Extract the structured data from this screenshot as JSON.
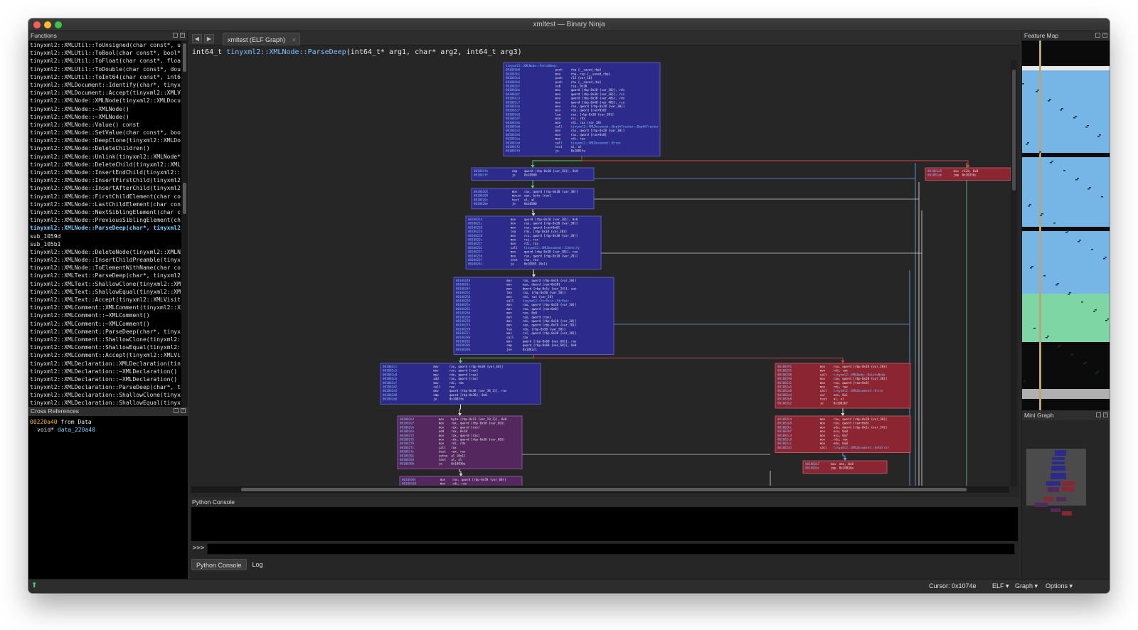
{
  "window": {
    "title": "xmltest — Binary Ninja"
  },
  "colors": {
    "block_blue": "#2c2a8a",
    "block_purple": "#54285e",
    "block_red": "#8b2532",
    "edge_white": "#d8d8d8",
    "edge_green": "#64c864",
    "edge_blue": "#6ea0d8",
    "edge_red": "#d24646",
    "selected_fn": "#7ad0ff",
    "xref_addr": "#f3b53c"
  },
  "functions_panel": {
    "title": "Functions",
    "items": [
      "tinyxml2::XMLUtil::ToUnsigned(char const*, unsigned int*)",
      "tinyxml2::XMLUtil::ToBool(char const*, bool*)",
      "tinyxml2::XMLUtil::ToFloat(char const*, float*)",
      "tinyxml2::XMLUtil::ToDouble(char const*, double*)",
      "tinyxml2::XMLUtil::ToInt64(char const*, int64_t*)",
      "tinyxml2::XMLDocument::Identify(char*, tinyxml2::XMLNode**)",
      "tinyxml2::XMLDocument::Accept(tinyxml2::XMLVisitor*) const",
      "tinyxml2::XMLNode::XMLNode(tinyxml2::XMLDocument*)",
      "tinyxml2::XMLNode::~XMLNode()",
      "tinyxml2::XMLNode::~XMLNode()",
      "tinyxml2::XMLNode::Value() const",
      "tinyxml2::XMLNode::SetValue(char const*, bool)",
      "tinyxml2::XMLNode::DeepClone(tinyxml2::XMLDocument*) const",
      "tinyxml2::XMLNode::DeleteChildren()",
      "tinyxml2::XMLNode::Unlink(tinyxml2::XMLNode*)",
      "tinyxml2::XMLNode::DeleteChild(tinyxml2::XMLNode*)",
      "tinyxml2::XMLNode::InsertEndChild(tinyxml2::XMLNode*)",
      "tinyxml2::XMLNode::InsertFirstChild(tinyxml2::XMLNode*)",
      "tinyxml2::XMLNode::InsertAfterChild(tinyxml2::XMLNode*)",
      "tinyxml2::XMLNode::FirstChildElement(char const*) const",
      "tinyxml2::XMLNode::LastChildElement(char const*) const",
      "tinyxml2::XMLNode::NextSiblingElement(char const*) const",
      "tinyxml2::XMLNode::PreviousSiblingElement(char const*) const",
      "tinyxml2::XMLNode::ParseDeep(char*, tinyxml2::StrPair*)",
      "sub_1059d",
      "sub_105b1",
      "tinyxml2::XMLNode::DeleteNode(tinyxml2::XMLNode*)",
      "tinyxml2::XMLNode::InsertChildPreamble(tinyxml2::XMLNode*) const",
      "tinyxml2::XMLNode::ToElementWithName(char const*) const",
      "tinyxml2::XMLText::ParseDeep(char*, tinyxml2::StrPair*)",
      "tinyxml2::XMLText::ShallowClone(tinyxml2::XMLDocument*) const",
      "tinyxml2::XMLText::ShallowEqual(tinyxml2::XMLNode const*) const",
      "tinyxml2::XMLText::Accept(tinyxml2::XMLVisitor*) const",
      "tinyxml2::XMLComment::XMLComment(tinyxml2::XMLDocument*)",
      "tinyxml2::XMLComment::~XMLComment()",
      "tinyxml2::XMLComment::~XMLComment()",
      "tinyxml2::XMLComment::ParseDeep(char*, tinyxml2::StrPair*)",
      "tinyxml2::XMLComment::ShallowClone(tinyxml2::XMLDocument*) const",
      "tinyxml2::XMLComment::ShallowEqual(tinyxml2::XMLNode const*) const",
      "tinyxml2::XMLComment::Accept(tinyxml2::XMLVisitor*) const",
      "tinyxml2::XMLDeclaration::XMLDeclaration(tinyxml2::XMLDocument*)",
      "tinyxml2::XMLDeclaration::~XMLDeclaration()",
      "tinyxml2::XMLDeclaration::~XMLDeclaration()",
      "tinyxml2::XMLDeclaration::ParseDeep(char*, tinyxml2::StrPair*)",
      "tinyxml2::XMLDeclaration::ShallowClone(tinyxml2::XMLDocument*) const",
      "tinyxml2::XMLDeclaration::ShallowEqual(tinyxml2::XMLNode const*) const"
    ],
    "selected_index": 23
  },
  "xrefs_panel": {
    "title": "Cross References",
    "entry_addr": "00220a40",
    "entry_from": "from Data",
    "entry_type": "void*",
    "entry_data": "data_220a40"
  },
  "tab": {
    "label": "xmltest (ELF Graph)",
    "close": "×"
  },
  "nav": {
    "back": "◀",
    "forward": "▶"
  },
  "signature": {
    "ret_type": "int64_t",
    "func_name": "tinyxml2::XMLNode::ParseDeep",
    "params": "(int64_t* arg1, char* arg2, int64_t arg3)"
  },
  "graph": {
    "blocks": [
      {
        "id": "entry",
        "color": "blue",
        "lines": [
          [
            "",
            "",
            "tinyxml2::XMLNode::ParseDeep:"
          ],
          [
            "001081b0",
            "push",
            "rbp {__saved_rbp}"
          ],
          [
            "001081b1",
            "mov",
            "rbp, rsp {__saved_rbp}"
          ],
          [
            "001081b4",
            "push",
            "r12 {var_10}"
          ],
          [
            "001081b6",
            "push",
            "rbx {__saved_rbx}"
          ],
          [
            "001081b7",
            "sub",
            "rsp, 0x30"
          ],
          [
            "001081bb",
            "mov",
            "qword [rbp-0x28 {var_30}], rdi"
          ],
          [
            "001081bf",
            "mov",
            "qword [rbp-0x30 {var_38}], rsi"
          ],
          [
            "001081c3",
            "mov",
            "qword [rbp-0x38 {var_40}], rdx"
          ],
          [
            "001081c7",
            "mov",
            "qword [rbp-0x40 {var_48}], rcx"
          ],
          [
            "001081cb",
            "mov",
            "rax, qword [rbp-0x28 {var_30}]"
          ],
          [
            "001081cf",
            "mov",
            "rdx, qword [rax+0x8]"
          ],
          [
            "001081d3",
            "lea",
            "rax, [rbp-0x30 {var_38}]"
          ],
          [
            "001081d7",
            "mov",
            "rsi, rdx"
          ],
          [
            "001081da",
            "mov",
            "rdi, rax {var_38}"
          ],
          [
            "001081dd",
            "call",
            "tinyxml2::XMLDocument::DepthTracker::DepthTracker"
          ],
          [
            "001081e2",
            "mov",
            "rax, qword [rbp-0x28 {var_30}]"
          ],
          [
            "001081e6",
            "mov",
            "rax, qword [rax+0x8]"
          ],
          [
            "001081ea",
            "mov",
            "rdi, rax"
          ],
          [
            "001081ed",
            "call",
            "tinyxml2::XMLDocument::Error"
          ],
          [
            "001081f2",
            "test",
            "al, al"
          ],
          [
            "001081f4",
            "je",
            "0x1081fa"
          ]
        ]
      },
      {
        "id": "b2",
        "color": "blue",
        "lines": [
          [
            "001081fa",
            "cmp",
            "qword [rbp-0x30 {var_38}], 0x0"
          ],
          [
            "001081ff",
            "je",
            "0x10580"
          ]
        ]
      },
      {
        "id": "b3",
        "color": "blue",
        "lines": [
          [
            "00108205",
            "mov",
            "rax, qword [rbp-0x30 {var_38}]"
          ],
          [
            "00108209",
            "movzx",
            "eax, byte [rax]"
          ],
          [
            "0010820c",
            "test",
            "al, al"
          ],
          [
            "0010820e",
            "je",
            "0x10580"
          ]
        ]
      },
      {
        "id": "b4",
        "color": "blue",
        "lines": [
          [
            "00108214",
            "mov",
            "qword [rbp-0x18 {var_20}], 0x0"
          ],
          [
            "0010821c",
            "mov",
            "rax, qword [rbp-0x28 {var_30}]"
          ],
          [
            "00108220",
            "mov",
            "rax, qword [rax+0x8]"
          ],
          [
            "00108224",
            "lea",
            "rdx, [rbp-0x18 {var_20}]"
          ],
          [
            "00108228",
            "mov",
            "rcx, qword [rbp-0x30 {var_38}]"
          ],
          [
            "0010822c",
            "mov",
            "rsi, rcx"
          ],
          [
            "0010822f",
            "mov",
            "rdi, rax"
          ],
          [
            "00108232",
            "call",
            "tinyxml2::XMLDocument::Identify"
          ],
          [
            "00108237",
            "mov",
            "qword [rbp-0x30 {var_38}], rax"
          ],
          [
            "0010823b",
            "mov",
            "rax, qword [rbp-0x18 {var_20}]"
          ],
          [
            "0010823f",
            "test",
            "rax, rax"
          ],
          [
            "00108242",
            "je",
            "0x10585 {0x1}"
          ]
        ]
      },
      {
        "id": "b5",
        "color": "blue",
        "lines": [
          [
            "00108248",
            "mov",
            "rax, qword [rbp-0x18 {var_20}]"
          ],
          [
            "0010824c",
            "mov",
            "eax, dword [rax+0x38]"
          ],
          [
            "0010824f",
            "mov",
            "dword [rbp-0x1c {var_24}], eax"
          ],
          [
            "00108252",
            "lea",
            "rax, [rbp-0x50 {var_58}]"
          ],
          [
            "00108256",
            "mov",
            "rdi, rax {var_58}"
          ],
          [
            "00108259",
            "call",
            "tinyxml2::StrPair::StrPair"
          ],
          [
            "0010825e",
            "mov",
            "rax, qword [rbp-0x28 {var_30}]"
          ],
          [
            "00108262",
            "mov",
            "rax, qword [rax+0x8]"
          ],
          [
            "00108266",
            "mov",
            "rax, 0x0"
          ],
          [
            "0010826d",
            "mov",
            "rax, qword [rax]"
          ],
          [
            "00108270",
            "mov",
            "rdi, qword [rbp-0x18 {var_20}]"
          ],
          [
            "00108274",
            "mov",
            "rax, qword [rbp-0x70 {var_78}]"
          ],
          [
            "00108278",
            "lea",
            "rdx, [rbp-0x50 {var_58}]"
          ],
          [
            "0010827c",
            "mov",
            "rsi, qword [rbp-0x30 {var_38}]"
          ],
          [
            "00108280",
            "call",
            "rax"
          ],
          [
            "00108282",
            "mov",
            "qword [rbp-0x60 {var_68}], rax"
          ],
          [
            "00108286",
            "cmp",
            "qword [rbp-0x60 {var_68}], 0x0"
          ],
          [
            "0010828b",
            "jne",
            "0x1082c1"
          ]
        ]
      },
      {
        "id": "b6",
        "color": "blue",
        "lines": [
          [
            "001082c1",
            "mov",
            "rax, qword [rbp-0x38 {var_40}]"
          ],
          [
            "001082c5",
            "mov",
            "rax, qword [rax]"
          ],
          [
            "001082c8",
            "mov",
            "rdx, qword [rax]"
          ],
          [
            "001082cb",
            "add",
            "rax, qword [rax]"
          ],
          [
            "001082cf",
            "mov",
            "rdi, rdx"
          ],
          [
            "001082d2",
            "call",
            "rax"
          ],
          [
            "001082d4",
            "mov",
            "qword [rbp-0x38 {var_38_1}], rax"
          ],
          [
            "001082d8",
            "cmp",
            "qword [rbp-0x38], 0x0"
          ],
          [
            "001082dd",
            "je",
            "0x1083fe"
          ]
        ]
      },
      {
        "id": "b7",
        "color": "purple",
        "lines": [
          [
            "001082e3",
            "mov",
            "byte [rbp-0x11 {var_19_1}], 0x0"
          ],
          [
            "001082e7",
            "mov",
            "rax, qword [rbp-0x58 {var_60}]"
          ],
          [
            "001082eb",
            "mov",
            "rax, qword [rax]"
          ],
          [
            "001082ee",
            "add",
            "rax, 0x18"
          ],
          [
            "001082f2",
            "mov",
            "rax, qword [rax]"
          ],
          [
            "001082f5",
            "mov",
            "rdx, qword [rbp-0x58 {var_60}]"
          ],
          [
            "001082f9",
            "mov",
            "rdi, rdx"
          ],
          [
            "001082fc",
            "call",
            "rax"
          ],
          [
            "001082fe",
            "test",
            "rax, rax"
          ],
          [
            "00108301",
            "setne",
            "al {0x1}"
          ],
          [
            "00108304",
            "test",
            "al, al"
          ],
          [
            "00108306",
            "je",
            "0x10836a"
          ]
        ]
      },
      {
        "id": "b8",
        "color": "purple",
        "lines": [
          [
            "0010830c",
            "mov",
            "rax, qword [rbp-0x58 {var_60}]"
          ],
          [
            "00108310",
            "mov",
            "rdi, rax"
          ]
        ]
      },
      {
        "id": "r1",
        "color": "red",
        "lines": [
          [
            "001081a5",
            "mov",
            "r12d, 0x0"
          ],
          [
            "001081ab",
            "jmp",
            "0x10358c"
          ]
        ]
      },
      {
        "id": "r2",
        "color": "red",
        "lines": [
          [
            "00108291",
            "mov",
            "rax, qword [rbp-0x18 {var_20}]"
          ],
          [
            "00108295",
            "mov",
            "rdi, rax"
          ],
          [
            "00108298",
            "call",
            "tinyxml2::XMLNode::DeleteNode"
          ],
          [
            "0010829d",
            "mov",
            "rax, qword [rbp-0x28 {var_30}]"
          ],
          [
            "001082a1",
            "mov",
            "rax, qword [rax+0x8]"
          ],
          [
            "001082a5",
            "mov",
            "rdi, rax"
          ],
          [
            "001082a8",
            "call",
            "tinyxml2::XMLDocument::Error"
          ],
          [
            "001082ad",
            "xor",
            "eax, 0x1"
          ],
          [
            "001082b0",
            "test",
            "al, al"
          ],
          [
            "001082b2",
            "je",
            "0x1082b7"
          ]
        ]
      },
      {
        "id": "r3",
        "color": "red",
        "lines": [
          [
            "001082b4",
            "mov",
            "rax, qword [rbp-0x28 {var_30}]"
          ],
          [
            "001082b8",
            "mov",
            "rax, qword [rax+0x8]"
          ],
          [
            "001082bc",
            "mov",
            "edx, dword [rbp-0x1c {var_24}]"
          ],
          [
            "001082bf",
            "mov",
            "ecx, 0x0"
          ],
          [
            "001082c4",
            "mov",
            "esi, 0x7"
          ],
          [
            "001082c9",
            "mov",
            "rdi, rax"
          ],
          [
            "001082cc",
            "mov",
            "edx, 0x0"
          ],
          [
            "001082d1",
            "call",
            "tinyxml2::XMLDocument::SetError"
          ]
        ]
      },
      {
        "id": "r4",
        "color": "red",
        "lines": [
          [
            "001082b7",
            "mov",
            "ebx, 0x0"
          ],
          [
            "001082bc",
            "jmp",
            "0x1083da"
          ]
        ]
      }
    ]
  },
  "console": {
    "title": "Python Console",
    "prompt": ">>>",
    "input_value": "",
    "tabs": [
      "Python Console",
      "Log"
    ],
    "active_tab": "Python Console"
  },
  "feature_map": {
    "title": "Feature Map"
  },
  "mini_graph": {
    "title": "Mini Graph"
  },
  "status": {
    "cursor": "Cursor: 0x1074e",
    "format": "ELF ▾",
    "view": "Graph ▾",
    "options": "Options ▾"
  }
}
